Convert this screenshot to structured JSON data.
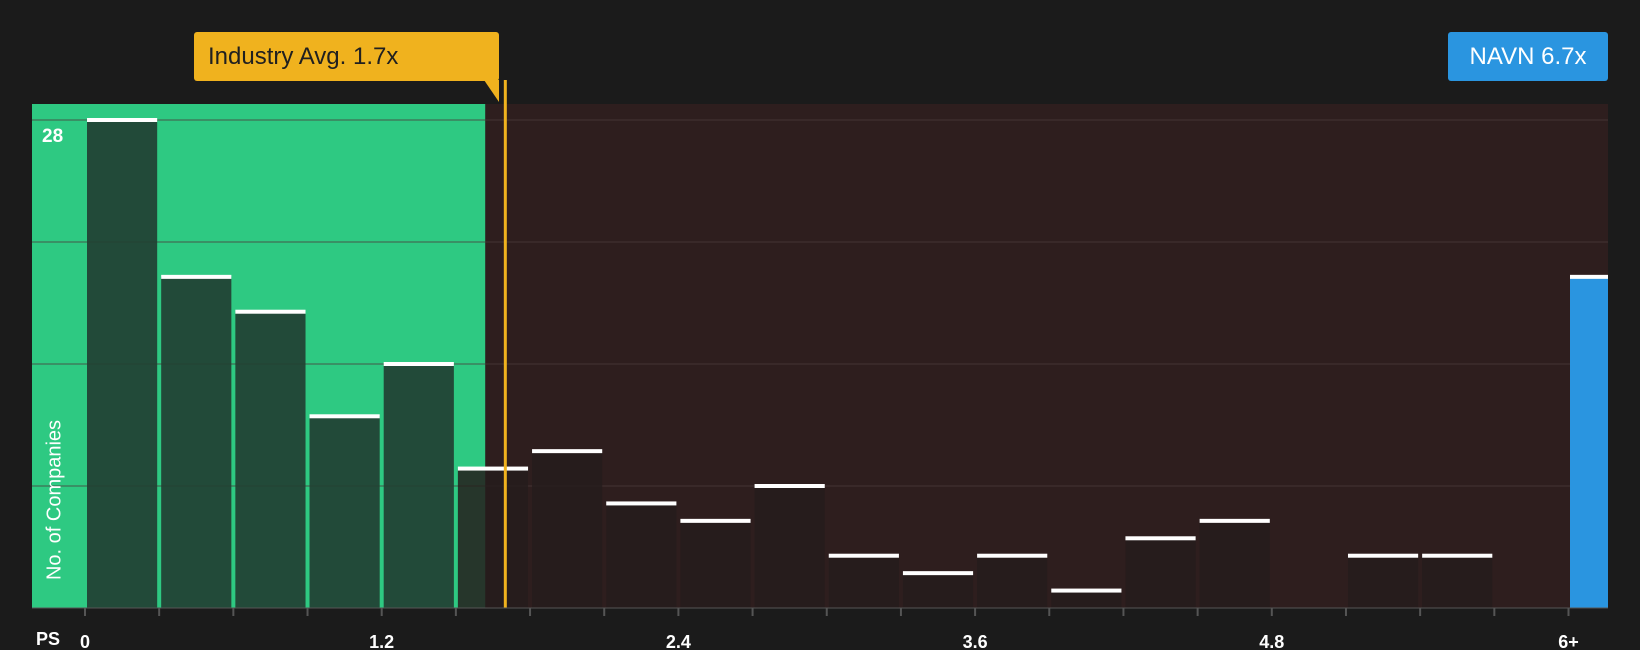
{
  "industry_badge": {
    "label": "Industry Avg. 1.7x"
  },
  "company_badge": {
    "label": "NAVN 6.7x"
  },
  "colors": {
    "background": "#1b1b1b",
    "below_avg_zone": "#2ec982",
    "above_avg_zone": "#2e1e1e",
    "bar_fill": "#223f33",
    "bar_fill_right": "#241c1c",
    "bar_cap": "#ffffff",
    "avg_line": "#f0b21e",
    "company_bar": "#2a95e0",
    "grid": "#4a3a3a"
  },
  "chart_data": {
    "type": "bar",
    "title": "",
    "xlabel": "PS",
    "ylabel": "No. of Companies",
    "ylim": [
      0,
      28
    ],
    "max_label": "28",
    "bin_width": 0.3,
    "x_ticks": [
      "0",
      "1.2",
      "2.4",
      "3.6",
      "4.8",
      "6+"
    ],
    "x_tick_values": [
      0,
      1.2,
      2.4,
      3.6,
      4.8,
      6.0
    ],
    "industry_avg": 1.7,
    "company": {
      "name": "NAVN",
      "value": 6.7,
      "count": 19
    },
    "bins": [
      {
        "x0": 0.0,
        "value": 28
      },
      {
        "x0": 0.3,
        "value": 19
      },
      {
        "x0": 0.6,
        "value": 17
      },
      {
        "x0": 0.9,
        "value": 11
      },
      {
        "x0": 1.2,
        "value": 14
      },
      {
        "x0": 1.5,
        "value": 8
      },
      {
        "x0": 1.8,
        "value": 9
      },
      {
        "x0": 2.1,
        "value": 6
      },
      {
        "x0": 2.4,
        "value": 5
      },
      {
        "x0": 2.7,
        "value": 7
      },
      {
        "x0": 3.0,
        "value": 3
      },
      {
        "x0": 3.3,
        "value": 2
      },
      {
        "x0": 3.6,
        "value": 3
      },
      {
        "x0": 3.9,
        "value": 1
      },
      {
        "x0": 4.2,
        "value": 4
      },
      {
        "x0": 4.5,
        "value": 5
      },
      {
        "x0": 4.8,
        "value": 0
      },
      {
        "x0": 5.1,
        "value": 3
      },
      {
        "x0": 5.4,
        "value": 3
      },
      {
        "x0": 5.7,
        "value": 0
      }
    ]
  }
}
